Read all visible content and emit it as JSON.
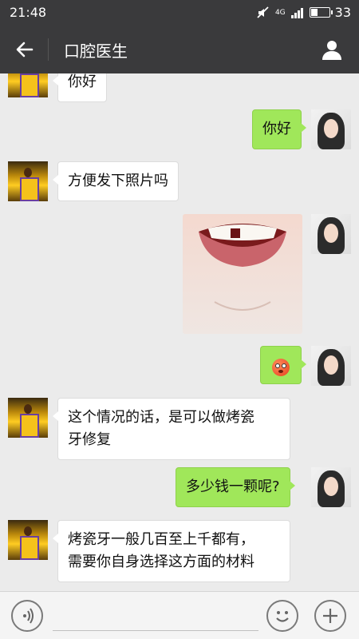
{
  "status_bar": {
    "time": "21:48",
    "network": "4G",
    "battery": "33",
    "battery_fraction": 0.33
  },
  "header": {
    "title": "口腔医生",
    "back_icon": "arrow-left-icon",
    "profile_icon": "person-icon"
  },
  "messages": [
    {
      "side": "left",
      "type": "text",
      "text": "你好"
    },
    {
      "side": "right",
      "type": "text",
      "text": "你好"
    },
    {
      "side": "left",
      "type": "text",
      "text": "方便发下照片吗"
    },
    {
      "side": "right",
      "type": "image"
    },
    {
      "side": "right",
      "type": "emoji",
      "emoji": "flushed-face-emoji"
    },
    {
      "side": "left",
      "type": "text",
      "lines": [
        "这个情况的话，是可以做烤瓷",
        "牙修复"
      ]
    },
    {
      "side": "right",
      "type": "text",
      "text": "多少钱一颗呢?"
    },
    {
      "side": "left",
      "type": "text",
      "lines": [
        "烤瓷牙一般几百至上千都有，",
        "需要你自身选择这方面的材料"
      ]
    }
  ],
  "input_bar": {
    "voice_icon": "voice-icon",
    "emoji_icon": "smiley-icon",
    "plus_icon": "plus-icon"
  }
}
